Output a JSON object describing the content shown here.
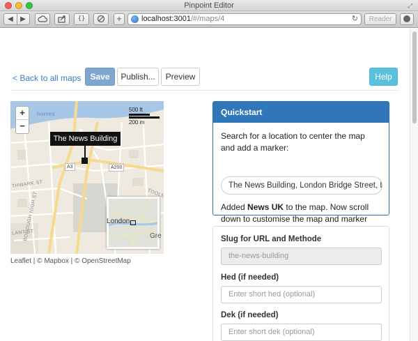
{
  "window": {
    "title": "Pinpoint Editor"
  },
  "browser": {
    "url_host": "localhost:3001",
    "url_path": "/#/maps/4",
    "reader_label": "Reader",
    "braces_label": "{}",
    "add_label": "+"
  },
  "nav": {
    "back_link": "< Back to all maps",
    "save": "Save",
    "publish": "Publish...",
    "preview": "Preview",
    "help": "Help"
  },
  "map": {
    "popup": "The News Building",
    "scale_ft": "500 ft",
    "scale_m": "200 m",
    "zoom_in": "+",
    "zoom_out": "−",
    "attribution": "Leaflet | © Mapbox | © OpenStreetMap",
    "minimap_label": "London",
    "minimap_label2": "Gre",
    "labels": {
      "thames": "hames",
      "a3": "A3",
      "a200": "A200",
      "southwark": "THWARK ST",
      "borough": "BOROUGH HIGH ST",
      "tooley": "TOOLEY",
      "lant": "LANT ST"
    }
  },
  "quickstart": {
    "title": "Quickstart",
    "instructions": "Search for a location to center the map and add a marker:",
    "search_value": "The News Building, London Bridge Street, London",
    "added_prefix": "Added ",
    "added_name": "News UK",
    "added_suffix": " to the map. Now scroll down to customise the map and marker styles."
  },
  "form": {
    "slug_label": "Slug for URL and Methode",
    "slug_value": "the-news-building",
    "hed_label": "Hed (if needed)",
    "hed_placeholder": "Enter short hed (optional)",
    "dek_label": "Dek (if needed)",
    "dek_placeholder": "Enter short dek (optional)"
  }
}
